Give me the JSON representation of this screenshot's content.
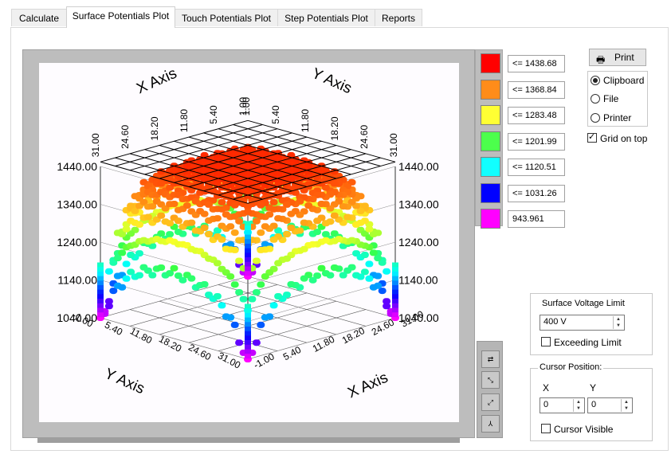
{
  "tabs": [
    {
      "label": "Calculate"
    },
    {
      "label": "Surface Potentials Plot"
    },
    {
      "label": "Touch Potentials Plot"
    },
    {
      "label": "Step Potentials Plot"
    },
    {
      "label": "Reports"
    }
  ],
  "active_tab": "Surface Potentials Plot",
  "legend": [
    {
      "color": "#ff0000",
      "label": "<= 1438.68"
    },
    {
      "color": "#ff8c1a",
      "label": "<= 1368.84"
    },
    {
      "color": "#ffff33",
      "label": "<= 1283.48"
    },
    {
      "color": "#4cff4c",
      "label": "<= 1201.99"
    },
    {
      "color": "#11ffff",
      "label": "<= 1120.51"
    },
    {
      "color": "#0000ff",
      "label": "<= 1031.26"
    },
    {
      "color": "#ff00ff",
      "label": "943.961"
    }
  ],
  "print": {
    "button_label": "Print",
    "options": [
      "Clipboard",
      "File",
      "Printer"
    ],
    "selected": "Clipboard",
    "grid_on_top_label": "Grid on top",
    "grid_on_top_checked": true
  },
  "surface_voltage": {
    "title": "Surface Voltage Limit",
    "value": "400 V",
    "exceeding_label": "Exceeding Limit",
    "exceeding_checked": false
  },
  "cursor": {
    "title": "Cursor Position:",
    "x_label": "X",
    "y_label": "Y",
    "x_value": "0",
    "y_value": "0",
    "visible_label": "Cursor Visible",
    "visible_checked": false
  },
  "tool_icons": [
    "rotate-xy-icon",
    "rotate-xz-icon",
    "rotate-zy-icon",
    "axes-icon"
  ],
  "chart_data": {
    "type": "surface3d",
    "x_axis_label": "X Axis",
    "y_axis_label": "Y Axis",
    "x_ticks": [
      "-1.00",
      "5.40",
      "11.80",
      "18.20",
      "24.60",
      "31.00"
    ],
    "y_ticks": [
      "31.00",
      "24.60",
      "18.20",
      "11.80",
      "5.40",
      "1.00"
    ],
    "y_ticks_bottom": [
      "-1.00",
      "5.40",
      "11.80",
      "18.20",
      "24.60",
      "31.00"
    ],
    "x_ticks_top": [
      "31.00",
      "24.60",
      "18.20",
      "11.80",
      "5.40",
      "1.00"
    ],
    "z_ticks": [
      "1440.00",
      "1340.00",
      "1240.00",
      "1140.00",
      "1040.00"
    ],
    "z_range": [
      943.961,
      1438.68
    ],
    "grid_on_top": true
  }
}
